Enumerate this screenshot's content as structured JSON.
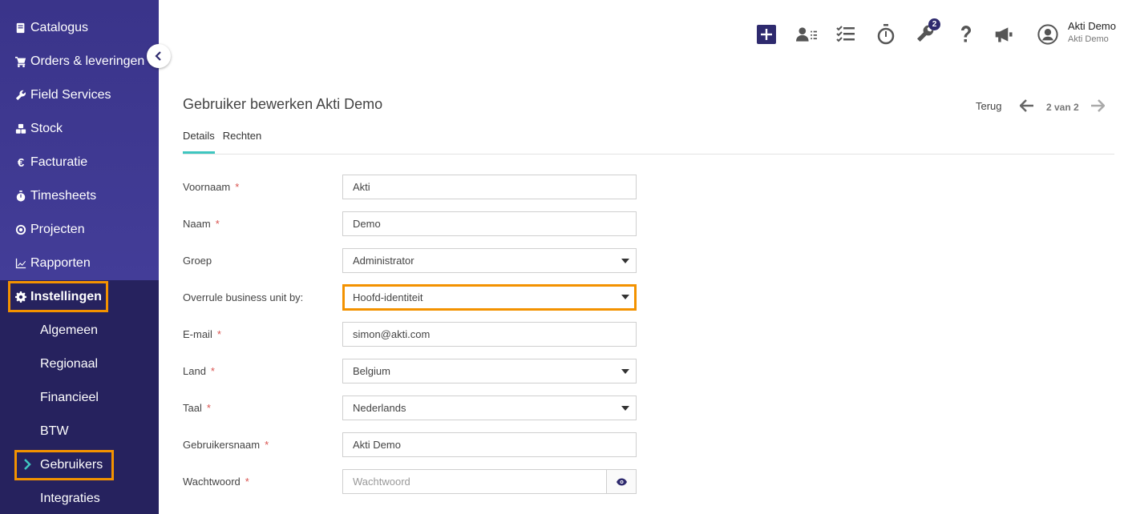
{
  "sidebar": {
    "items": [
      {
        "label": "Catalogus",
        "icon": "book-icon"
      },
      {
        "label": "Orders & leveringen",
        "icon": "cart-icon"
      },
      {
        "label": "Field Services",
        "icon": "wrench-icon"
      },
      {
        "label": "Stock",
        "icon": "boxes-icon"
      },
      {
        "label": "Facturatie",
        "icon": "euro-icon"
      },
      {
        "label": "Timesheets",
        "icon": "stopwatch-icon"
      },
      {
        "label": "Projecten",
        "icon": "target-icon"
      },
      {
        "label": "Rapporten",
        "icon": "chart-line-icon"
      }
    ],
    "active_section": {
      "label": "Instellingen",
      "icon": "gear-icon"
    },
    "subitems": [
      "Algemeen",
      "Regionaal",
      "Financieel",
      "BTW",
      "Gebruikers",
      "Integraties"
    ],
    "active_subitem": "Gebruikers"
  },
  "topbar": {
    "badge_count": "2",
    "user_name": "Akti Demo",
    "user_sub": "Akti Demo",
    "icons": [
      "plus-icon",
      "user-list-icon",
      "checklist-icon",
      "stopwatch-icon",
      "wrench-icon",
      "question-icon",
      "megaphone-icon",
      "user-circle-icon"
    ]
  },
  "page": {
    "title": "Gebruiker bewerken Akti Demo",
    "back_label": "Terug",
    "pager": "2 van 2",
    "tabs": [
      "Details",
      "Rechten"
    ]
  },
  "form": {
    "fields": [
      {
        "label": "Voornaam",
        "required": "*",
        "value": "Akti"
      },
      {
        "label": "Naam",
        "required": "*",
        "value": "Demo"
      },
      {
        "label": "Groep",
        "required": "",
        "value": "Administrator"
      },
      {
        "label": "Overrule business unit by:",
        "required": "",
        "value": "Hoofd-identiteit"
      },
      {
        "label": "E-mail",
        "required": "*",
        "value": "simon@akti.com"
      },
      {
        "label": "Land",
        "required": "*",
        "value": "Belgium"
      },
      {
        "label": "Taal",
        "required": "*",
        "value": "Nederlands"
      },
      {
        "label": "Gebruikersnaam",
        "required": "*",
        "value": "Akti Demo"
      },
      {
        "label": "Wachtwoord",
        "required": "*",
        "placeholder": "Wachtwoord"
      }
    ]
  },
  "colors": {
    "sidebar": "#3a348a",
    "sidebar_lower": "#26225e",
    "highlight": "#f39200",
    "tab_accent": "#3fc6c0",
    "primary": "#2e2a6e"
  }
}
